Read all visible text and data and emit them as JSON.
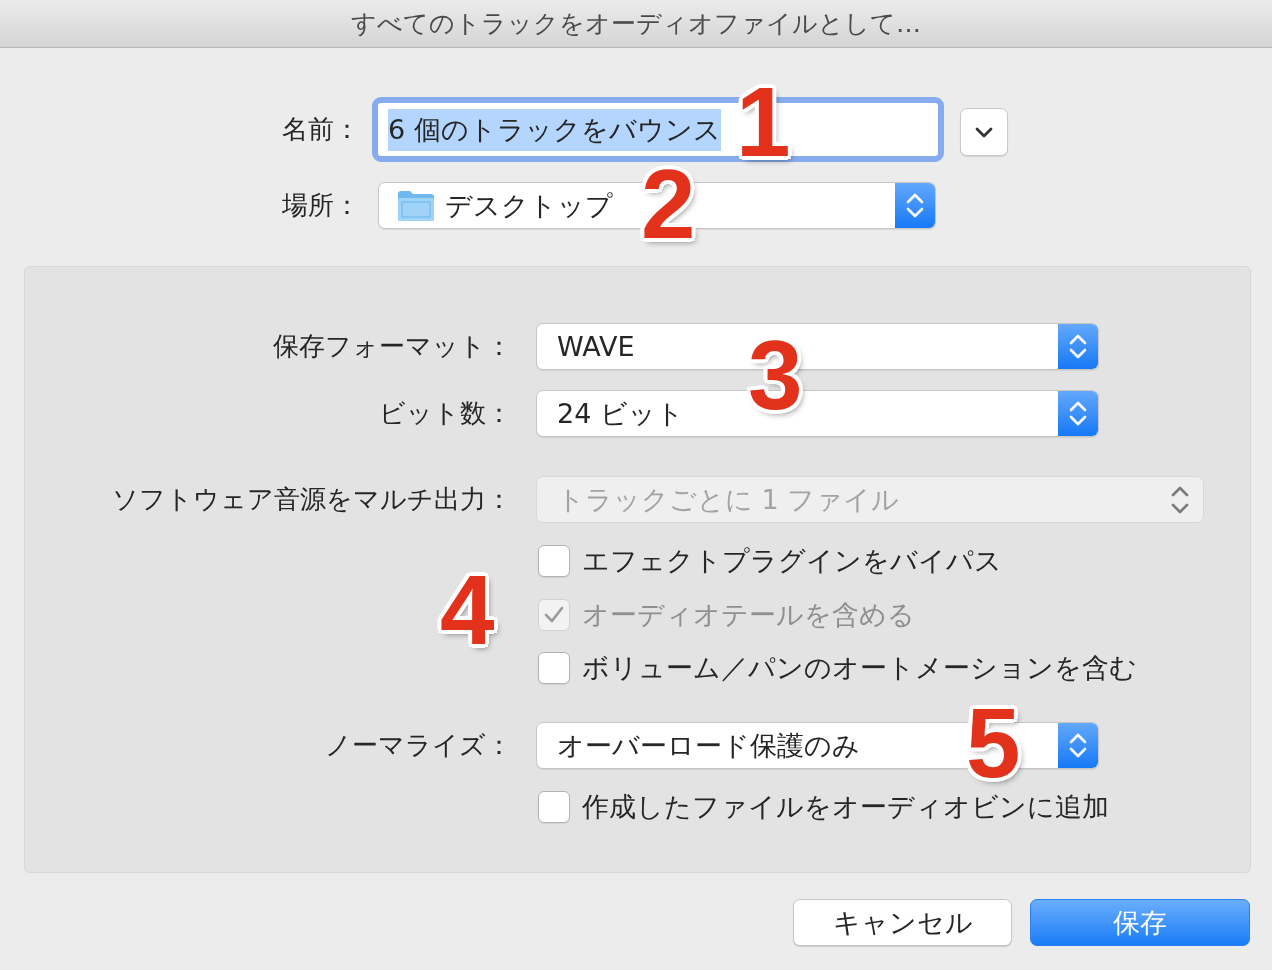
{
  "window": {
    "title": "すべてのトラックをオーディオファイルとして…"
  },
  "name_field": {
    "label": "名前：",
    "value": "6 個のトラックをバウンス",
    "focused": true,
    "text_selected": true
  },
  "location": {
    "label": "場所：",
    "value": "デスクトップ"
  },
  "options": [
    {
      "kind": "popup",
      "label": "保存フォーマット：",
      "value": "WAVE",
      "disabled": false
    },
    {
      "kind": "popup",
      "label": "ビット数：",
      "value": "24 ビット",
      "disabled": false
    },
    {
      "kind": "popup",
      "label": "ソフトウェア音源をマルチ出力：",
      "value": "トラックごとに 1 ファイル",
      "disabled": true
    },
    {
      "kind": "checkbox",
      "label": "エフェクトプラグインをバイパス",
      "checked": false,
      "disabled": false
    },
    {
      "kind": "checkbox",
      "label": "オーディオテールを含める",
      "checked": true,
      "disabled": true
    },
    {
      "kind": "checkbox",
      "label": "ボリューム／パンのオートメーションを含む",
      "checked": false,
      "disabled": false
    },
    {
      "kind": "popup",
      "label": "ノーマライズ：",
      "value": "オーバーロード保護のみ",
      "disabled": false
    },
    {
      "kind": "checkbox",
      "label": "作成したファイルをオーディオビンに追加",
      "checked": false,
      "disabled": false
    }
  ],
  "buttons": [
    {
      "label": "キャンセル",
      "default": false
    },
    {
      "label": "保存",
      "default": true
    }
  ],
  "callouts": [
    "1",
    "2",
    "3",
    "4",
    "5"
  ]
}
